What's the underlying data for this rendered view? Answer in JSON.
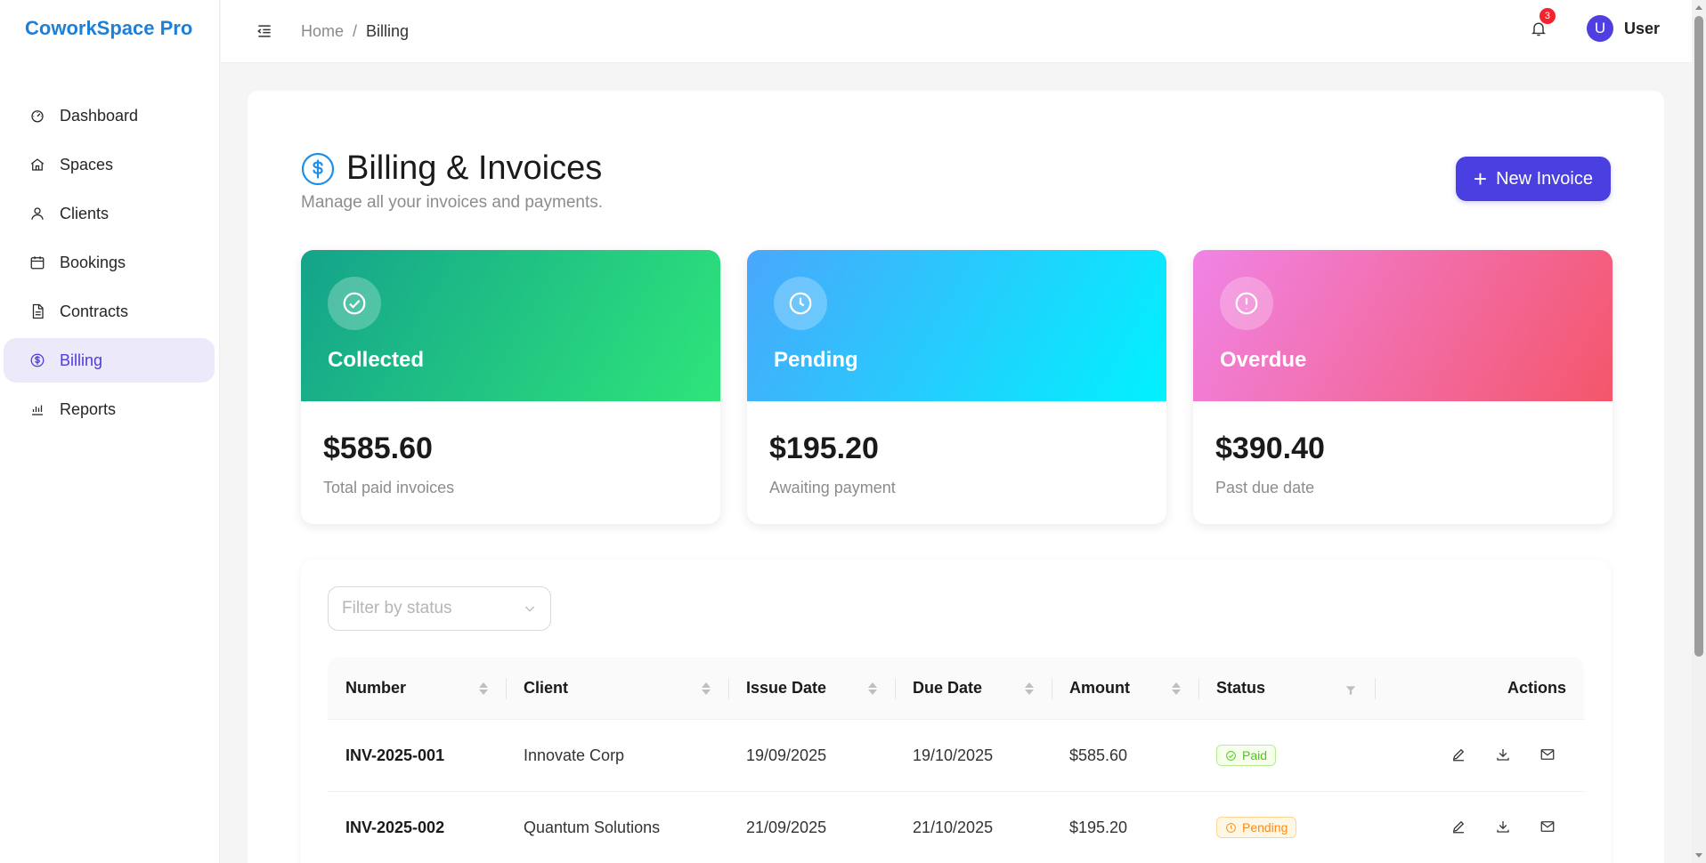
{
  "app": {
    "brand": "CoworkSpace Pro"
  },
  "sidebar": {
    "items": [
      {
        "label": "Dashboard",
        "icon": "dashboard-icon"
      },
      {
        "label": "Spaces",
        "icon": "home-icon"
      },
      {
        "label": "Clients",
        "icon": "user-icon"
      },
      {
        "label": "Bookings",
        "icon": "calendar-icon"
      },
      {
        "label": "Contracts",
        "icon": "document-icon"
      },
      {
        "label": "Billing",
        "icon": "dollar-circle-icon",
        "active": true
      },
      {
        "label": "Reports",
        "icon": "bar-chart-icon"
      }
    ]
  },
  "header": {
    "breadcrumb": {
      "home": "Home",
      "separator": "/",
      "current": "Billing"
    },
    "notifications": {
      "count": "3"
    },
    "user": {
      "initial": "U",
      "name": "User"
    }
  },
  "page": {
    "title": "Billing & Invoices",
    "subtitle": "Manage all your invoices and payments.",
    "new_button": "New Invoice"
  },
  "stats": [
    {
      "label": "Collected",
      "value": "$585.60",
      "desc": "Total paid invoices",
      "color_from": "#14a38b",
      "color_to": "#2ee57a"
    },
    {
      "label": "Pending",
      "value": "$195.20",
      "desc": "Awaiting payment",
      "color_from": "#4aa7fb",
      "color_to": "#00f2fe"
    },
    {
      "label": "Overdue",
      "value": "$390.40",
      "desc": "Past due date",
      "color_from": "#f084e6",
      "color_to": "#f4566a"
    }
  ],
  "filter": {
    "placeholder": "Filter by status"
  },
  "table": {
    "columns": [
      "Number",
      "Client",
      "Issue Date",
      "Due Date",
      "Amount",
      "Status",
      "Actions"
    ],
    "rows": [
      {
        "number": "INV-2025-001",
        "client": "Innovate Corp",
        "issue_date": "19/09/2025",
        "due_date": "19/10/2025",
        "amount": "$585.60",
        "status": "Paid"
      },
      {
        "number": "INV-2025-002",
        "client": "Quantum Solutions",
        "issue_date": "21/09/2025",
        "due_date": "21/10/2025",
        "amount": "$195.20",
        "status": "Pending"
      }
    ]
  },
  "colors": {
    "accent": "#4a3fe0",
    "brand": "#1e7fd6",
    "paid": "#52c41a",
    "pending": "#fa8c16"
  }
}
